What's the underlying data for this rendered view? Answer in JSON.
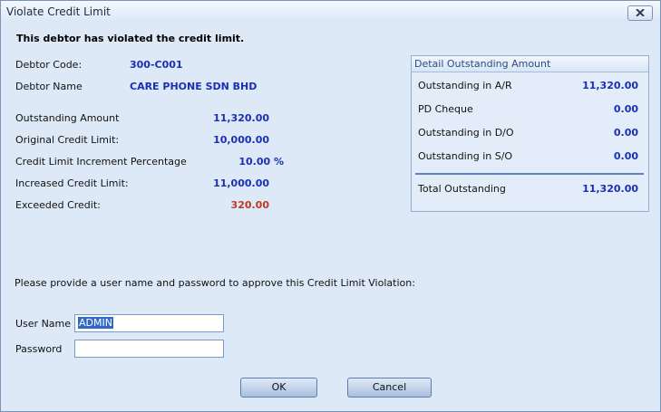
{
  "window": {
    "title": "Violate Credit Limit"
  },
  "headline": "This debtor has violated the credit limit.",
  "debtor": {
    "code_label": "Debtor Code:",
    "code": "300-C001",
    "name_label": "Debtor Name",
    "name": "CARE PHONE SDN BHD"
  },
  "credit": {
    "outstanding_label": "Outstanding Amount",
    "outstanding": "11,320.00",
    "original_label": "Original Credit Limit:",
    "original": "10,000.00",
    "increment_label": "Credit Limit Increment Percentage",
    "increment": "10.00 %",
    "increased_label": "Increased Credit Limit:",
    "increased": "11,000.00",
    "exceeded_label": "Exceeded Credit:",
    "exceeded": "320.00"
  },
  "detail": {
    "title": "Detail Outstanding Amount",
    "rows": [
      {
        "label": "Outstanding in A/R",
        "value": "11,320.00"
      },
      {
        "label": "PD Cheque",
        "value": "0.00"
      },
      {
        "label": "Outstanding in D/O",
        "value": "0.00"
      },
      {
        "label": "Outstanding in S/O",
        "value": "0.00"
      }
    ],
    "total_label": "Total Outstanding",
    "total": "11,320.00"
  },
  "auth": {
    "prompt": "Please provide a user name and password to approve this Credit Limit Violation:",
    "user_label": "User Name",
    "user_value": "ADMIN",
    "password_label": "Password",
    "password_value": ""
  },
  "buttons": {
    "ok": "OK",
    "cancel": "Cancel"
  },
  "colors": {
    "value_blue": "#1a2fb4",
    "exceeded_red": "#bf3a24",
    "dialog_bg": "#dde9f7"
  }
}
